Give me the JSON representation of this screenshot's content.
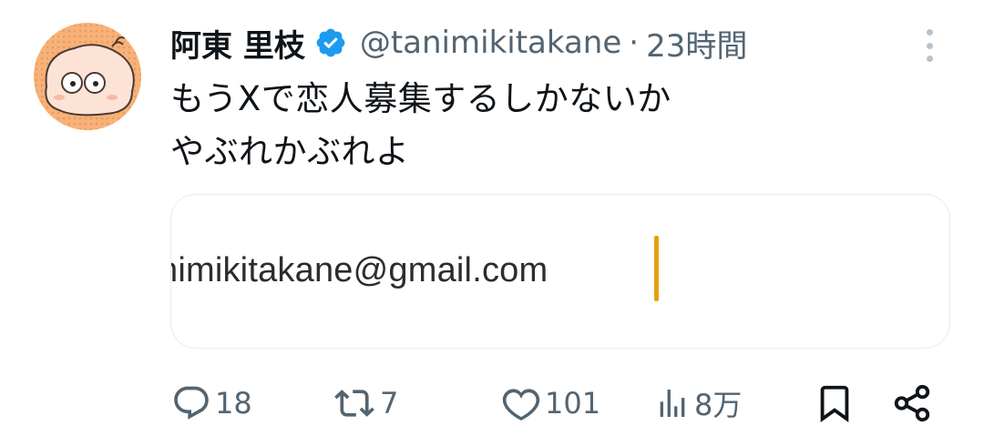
{
  "tweet": {
    "display_name": "阿東 里枝",
    "handle": "@tanimikitakane",
    "separator": "·",
    "time": "23時間",
    "text_lines": [
      "もうXで恋人募集するしかないか",
      "やぶれかぶれよ"
    ],
    "verified": true,
    "verified_color": "#1d9bf0"
  },
  "card": {
    "text": "nimikitakane@gmail.com",
    "caret_color": "#e4a10f"
  },
  "actions": {
    "reply": {
      "icon": "reply-icon",
      "count": "18"
    },
    "retweet": {
      "icon": "retweet-icon",
      "count": "7"
    },
    "like": {
      "icon": "heart-icon",
      "count": "101"
    },
    "views": {
      "icon": "views-icon",
      "count": "8万"
    },
    "bookmark": {
      "icon": "bookmark-icon"
    },
    "share": {
      "icon": "share-icon"
    }
  },
  "colors": {
    "text": "#0f1419",
    "secondary": "#536471",
    "avatar_bg": "#f4a566"
  }
}
